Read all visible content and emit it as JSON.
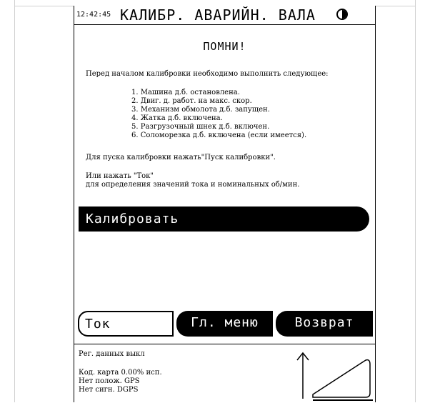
{
  "header": {
    "clock": "12:42:45",
    "title": "КАЛИБР. АВАРИЙН. ВАЛА"
  },
  "main": {
    "heading": "ПОМНИ!",
    "intro": "Перед началом калибровки необходимо выполнить следующее:",
    "steps": [
      "1. Машина д.б. остановлена.",
      "2. Двиг. д. работ. на макс. скор.",
      "3. Механизм обмолота д.б. запущен.",
      "4. Жатка д.б. включена.",
      "5. Разгрузочный шнек д.б. включен.",
      "6. Соломорезка д.б. включена (если имеется)."
    ],
    "start_hint": "Для пуска калибровки нажать\"Пуск калибровки\".",
    "alt_hint_1": "Или нажать \"Ток\"",
    "alt_hint_2": "для определения значений тока и номинальных об/мин."
  },
  "buttons": {
    "calibrate": "Калибровать",
    "current": "Ток",
    "main_menu": "Гл. меню",
    "back": "Возврат"
  },
  "status": {
    "logging": "Рег. данных выкл",
    "map_code": "Код. карта   0.00% исп.",
    "no_position": "Нет полож. GPS",
    "no_signal": "Нет сигн. DGPS"
  },
  "icons": {
    "contrast": "contrast-icon",
    "up_arrow": "up-arrow-icon",
    "slope": "slope-triangle-icon"
  }
}
